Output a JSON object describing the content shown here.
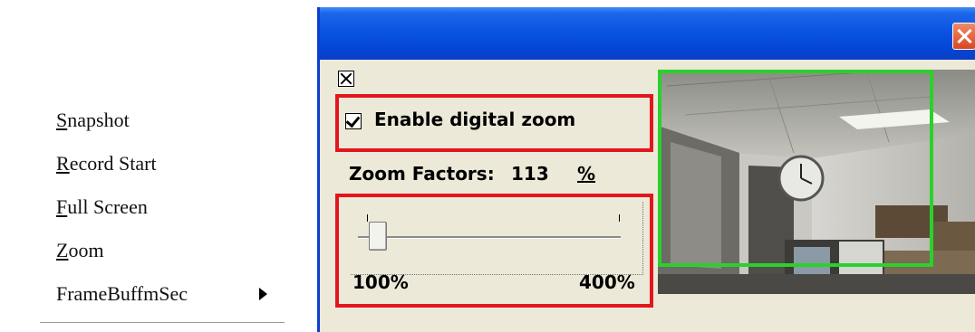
{
  "context_menu": {
    "items": [
      {
        "mnemonic": "S",
        "rest": "napshot"
      },
      {
        "mnemonic": "R",
        "rest": "ecord Start"
      },
      {
        "mnemonic": "F",
        "rest": "ull Screen"
      },
      {
        "mnemonic": "Z",
        "rest": "oom"
      },
      {
        "mnemonic": "",
        "rest": "FrameBuffmSec"
      }
    ]
  },
  "dialog": {
    "enable_digital_zoom": {
      "label": "Enable digital zoom",
      "checked": true
    },
    "zoom_factors": {
      "label": "Zoom Factors:",
      "value": "113",
      "unit": "%"
    },
    "slider": {
      "min_label": "100%",
      "max_label": "400%",
      "min": 100,
      "max": 400,
      "value": 113
    },
    "highlight_color": "#e3161e",
    "zoom_region_color": "#2bd12b"
  }
}
